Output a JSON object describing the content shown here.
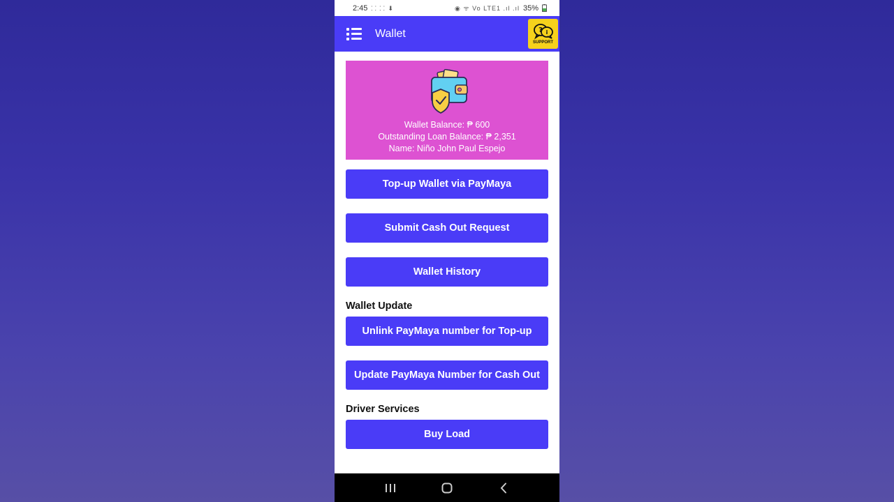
{
  "status_bar": {
    "time": "2:45",
    "left_icons": "⸬ ⸬ ⬇",
    "right_icons": "◉ ᯤ Vo LTE1 .ıl .ıl",
    "battery": "35%"
  },
  "app_bar": {
    "title": "Wallet",
    "menu_icon": "list-icon",
    "support_label": "SUPPORT"
  },
  "wallet_card": {
    "background": "#dd52d2",
    "balance_text": "Wallet Balance: ₱ 600",
    "loan_text": "Outstanding Loan Balance: ₱ 2,351",
    "name_text": "Name: Niño John Paul Espejo"
  },
  "buttons": {
    "topup": "Top-up Wallet via PayMaya",
    "cashout": "Submit Cash Out Request",
    "history": "Wallet History",
    "unlink": "Unlink PayMaya number for Top-up",
    "update": "Update PayMaya Number for Cash Out",
    "buy_load": "Buy Load"
  },
  "sections": {
    "wallet_update": "Wallet Update",
    "driver_services": "Driver Services"
  },
  "colors": {
    "primary": "#4a3cf7",
    "support": "#f6d21c"
  }
}
